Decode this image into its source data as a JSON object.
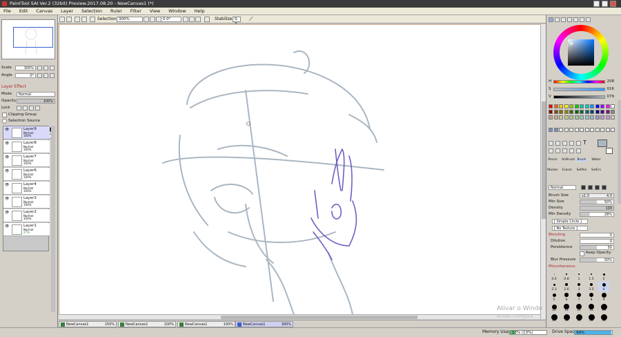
{
  "window": {
    "title": "PaintTool SAI Ver.2 (32bit) Preview.2017.08.20 - NewCanvas1 (*)"
  },
  "menu": [
    "File",
    "Edit",
    "Canvas",
    "Layer",
    "Selection",
    "Ruler",
    "Filter",
    "View",
    "Window",
    "Help"
  ],
  "toolbar": {
    "selection_label": "Selection",
    "zoom": "300%",
    "angle": "0.0°",
    "stabilizer_label": "Stabilizer",
    "stabilizer_value": "S-2"
  },
  "navigator": {
    "scale_label": "Scale",
    "scale_value": "300%",
    "angle_label": "Angle",
    "angle_value": "0°"
  },
  "layer_effect": {
    "title": "Layer Effect",
    "mode_label": "Mode",
    "mode_value": "Normal",
    "opacity_label": "Opacity",
    "opacity_value": "100%",
    "lock_label": "Lock",
    "clipping_label": "Clipping Group",
    "selection_source_label": "Selection Source"
  },
  "layers": [
    {
      "name": "Layer9",
      "mode": "Normal",
      "opacity": "100%",
      "selected": true
    },
    {
      "name": "Layer8",
      "mode": "Normal",
      "opacity": "100%"
    },
    {
      "name": "Layer7",
      "mode": "Normal",
      "opacity": "100%"
    },
    {
      "name": "Layer6",
      "mode": "Normal",
      "opacity": "100%"
    },
    {
      "name": "Layer4",
      "mode": "Normal",
      "opacity": "100%"
    },
    {
      "name": "Layer3",
      "mode": "Normal",
      "opacity": "100%"
    },
    {
      "name": "Layer2",
      "mode": "Normal",
      "opacity": "100%"
    },
    {
      "name": "Layer1",
      "mode": "Normal",
      "opacity": "27%"
    }
  ],
  "color": {
    "h_label": "H",
    "h_value": "208",
    "s_label": "S",
    "s_value": "016",
    "v_label": "V",
    "v_value": "079",
    "current": "#abb6c0"
  },
  "tools": {
    "row1": [
      "Pencil",
      "AirBrush",
      "Brush",
      "Water"
    ],
    "row2": [
      "Marker",
      "Eraser",
      "SelPen",
      "SelErs"
    ],
    "blend_mode": "Normal"
  },
  "brush": {
    "size_label": "Brush Size",
    "size_mult": "x1.0",
    "size_value": "4.0",
    "min_size_label": "Min Size",
    "min_size_value": "50%",
    "density_label": "Density",
    "density_value": "100",
    "min_density_label": "Min Density",
    "min_density_value": "28%",
    "shape": "[ Simple Circle ]",
    "texture": "[ No Texture ]",
    "blending_title": "Blending",
    "blending_value": "0",
    "dilution_label": "Dilution",
    "dilution_value": "0",
    "persistence_label": "Persistence",
    "persistence_value": "50",
    "keep_opacity_label": "Keep Opacity",
    "blur_label": "Blur Pressure",
    "blur_value": "50%",
    "misc_title": "Miscellaneous"
  },
  "brush_sizes": [
    [
      "0.6",
      "0.8",
      "1",
      "1.5",
      "2"
    ],
    [
      "2.3",
      "2.6",
      "3",
      "3.5",
      "4"
    ],
    [
      "5",
      "6",
      "7",
      "8",
      "9"
    ],
    [
      "10",
      "12",
      "14",
      "16",
      "20"
    ],
    [
      "25",
      "30",
      "35",
      "40",
      "50"
    ]
  ],
  "doc_tabs": [
    {
      "name": "NewCanvas1",
      "zoom": "150%"
    },
    {
      "name": "NewCanvas1",
      "zoom": "100%"
    },
    {
      "name": "NewCanvas1",
      "zoom": "100%"
    },
    {
      "name": "NewCanvas1",
      "zoom": "300%",
      "active": true
    }
  ],
  "status": {
    "memory_label": "Memory Usage",
    "memory_value": "13% (13%)",
    "memory_fraction": 0.13,
    "drive_label": "Drive Space",
    "drive_value": "99%",
    "drive_fraction": 0.99
  },
  "watermark": {
    "line1": "Ativar o Windo",
    "line2": "Acesse Configura"
  },
  "colors": {
    "accent": "#3a5fcd",
    "sketch": "#a9b6c2",
    "hand": "#6b5fc4",
    "highlight": "#d9d9fb"
  }
}
